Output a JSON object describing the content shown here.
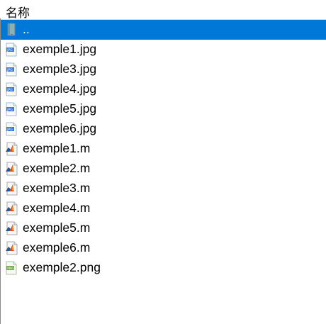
{
  "header": {
    "name_column": "名称"
  },
  "files": [
    {
      "label": "..",
      "type": "folder-up",
      "selected": true
    },
    {
      "label": "exemple1.jpg",
      "type": "jpg"
    },
    {
      "label": "exemple3.jpg",
      "type": "jpg"
    },
    {
      "label": "exemple4.jpg",
      "type": "jpg"
    },
    {
      "label": "exemple5.jpg",
      "type": "jpg"
    },
    {
      "label": "exemple6.jpg",
      "type": "jpg"
    },
    {
      "label": "exemple1.m",
      "type": "m"
    },
    {
      "label": "exemple2.m",
      "type": "m"
    },
    {
      "label": "exemple3.m",
      "type": "m"
    },
    {
      "label": "exemple4.m",
      "type": "m"
    },
    {
      "label": "exemple5.m",
      "type": "m"
    },
    {
      "label": "exemple6.m",
      "type": "m"
    },
    {
      "label": "exemple2.png",
      "type": "png"
    }
  ],
  "colors": {
    "selection": "#0078d7",
    "jpg_icon": "#3b78d8",
    "png_icon": "#6ea84c",
    "matlab_icon": "#d9531e"
  }
}
